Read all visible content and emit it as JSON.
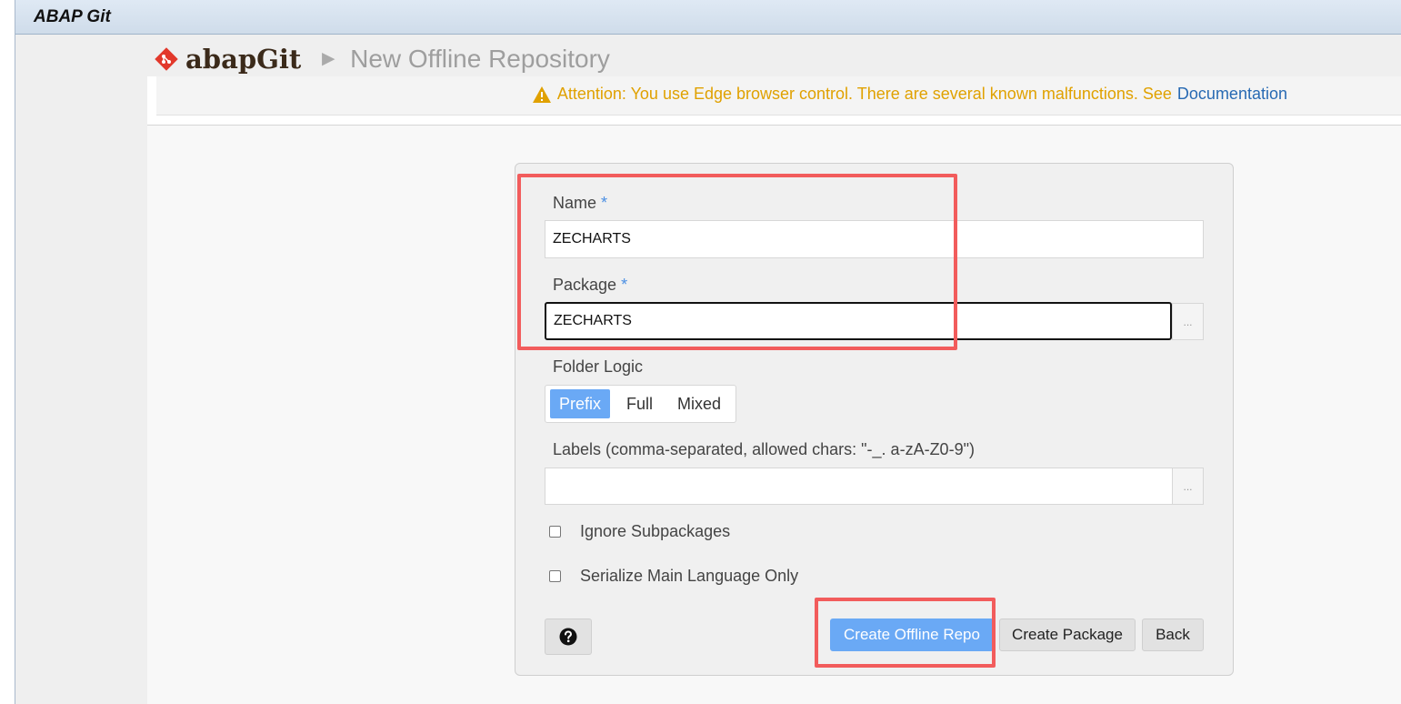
{
  "window": {
    "title": "ABAP Git"
  },
  "header": {
    "logo_text": "abapGit",
    "breadcrumb_separator": "►",
    "page_title": "New Offline Repository",
    "notice": {
      "text": "Attention: You use Edge browser control. There are several known malfunctions. See",
      "link_text": "Documentation",
      "icon": "warning-icon"
    }
  },
  "form": {
    "name": {
      "label": "Name",
      "required_mark": "*",
      "value": "ZECHARTS"
    },
    "package": {
      "label": "Package",
      "required_mark": "*",
      "value": "ZECHARTS",
      "browse_label": "..."
    },
    "folder_logic": {
      "label": "Folder Logic",
      "options": [
        "Prefix",
        "Full",
        "Mixed"
      ],
      "selected": "Prefix"
    },
    "labels": {
      "label": "Labels (comma-separated, allowed chars: \"-_. a-zA-Z0-9\")",
      "value": "",
      "browse_label": "..."
    },
    "ignore_subpackages": {
      "label": "Ignore Subpackages",
      "checked": false
    },
    "serialize_main_language": {
      "label": "Serialize Main Language Only",
      "checked": false
    }
  },
  "actions": {
    "help_icon": "question-circle-icon",
    "create_offline_repo": "Create Offline Repo",
    "create_package": "Create Package",
    "back": "Back"
  },
  "colors": {
    "accent": "#6aa9f5",
    "warning": "#e0a100",
    "link": "#286ab3",
    "highlight": "#f25c5c",
    "logo_red": "#e2382b"
  }
}
